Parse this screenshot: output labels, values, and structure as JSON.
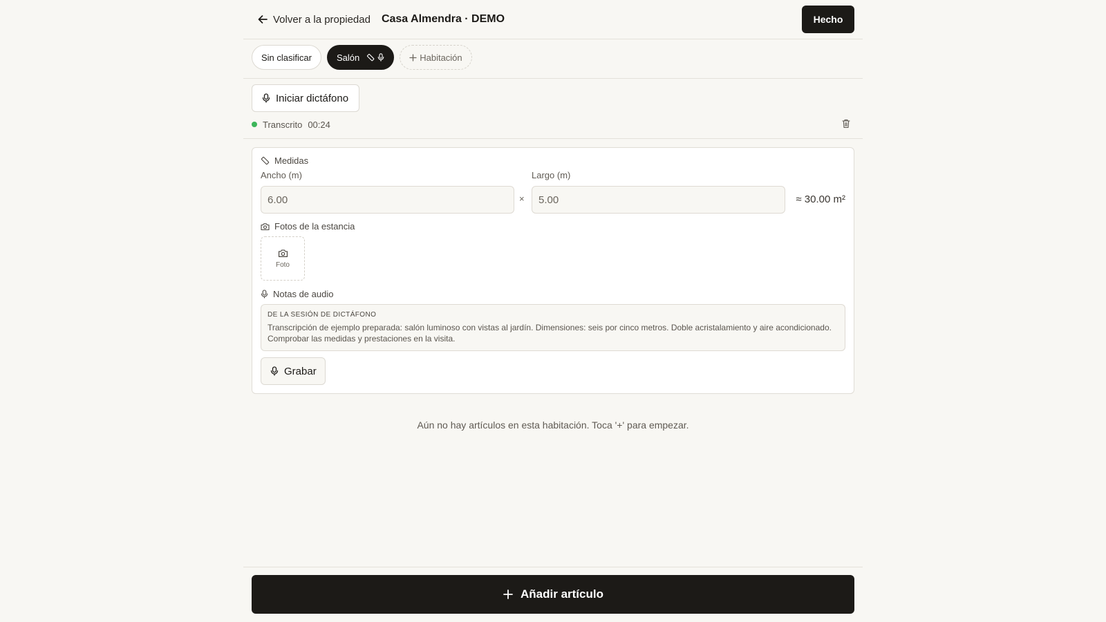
{
  "header": {
    "back_label": "Volver a la propiedad",
    "property_title": "Casa Almendra · DEMO",
    "done_label": "Hecho"
  },
  "tabs": [
    {
      "label": "Sin clasificar",
      "active": false
    },
    {
      "label": "Salón",
      "active": true,
      "icons": [
        "ruler-icon",
        "mic-icon"
      ]
    },
    {
      "label": "Habitación",
      "add": true,
      "icon": "plus-icon"
    }
  ],
  "dictaphone": {
    "start_label": "Iniciar dictáfono",
    "status": "Transcrito",
    "duration": "00:24"
  },
  "measures": {
    "section_title": "Medidas",
    "width_label": "Ancho (m)",
    "width_value": "6.00",
    "length_label": "Largo (m)",
    "length_value": "5.00",
    "times": "×",
    "area": "≈ 30.00 m²"
  },
  "photos": {
    "section_title": "Fotos de la estancia",
    "add_label": "Foto"
  },
  "audio_notes": {
    "section_title": "Notas de audio",
    "transcript_heading": "DE LA SESIÓN DE DICTÁFONO",
    "transcript_text": "Transcripción de ejemplo preparada: salón luminoso con vistas al jardín. Dimensiones: seis por cinco metros. Doble acristalamiento y aire acondicionado. Comprobar las medidas y prestaciones en la visita.",
    "record_label": "Grabar"
  },
  "empty_message": "Aún no hay artículos en esta habitación. Toca '+' para empezar.",
  "add_item_label": "Añadir artículo",
  "colors": {
    "background": "#f8f7f3",
    "primary": "#1c1a17",
    "status_green": "#3cb55a"
  }
}
